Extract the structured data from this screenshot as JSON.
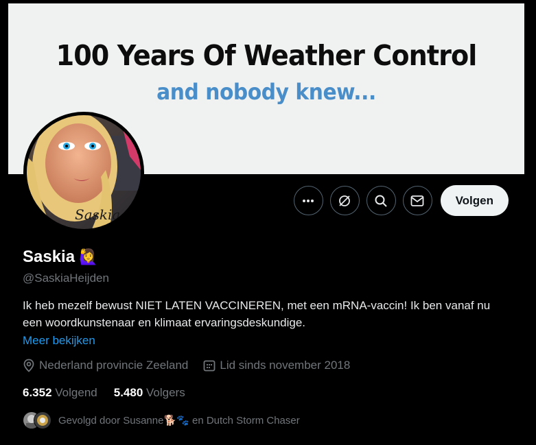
{
  "banner": {
    "line1": "100 Years Of Weather Control",
    "line2": "and nobody knew..."
  },
  "avatar": {
    "signature": "Saskia"
  },
  "actions": {
    "follow_label": "Volgen"
  },
  "profile": {
    "name": "Saskia",
    "name_emoji": "🙋‍♀️",
    "handle": "@SaskiaHeijden",
    "bio": "Ik heb mezelf bewust NIET LATEN VACCINEREN, met een mRNA-vaccin! Ik ben vanaf nu een woordkunstenaar en klimaat ervaringsdeskundige.",
    "more_link": "Meer bekijken",
    "location": "Nederland provincie Zeeland",
    "joined": "Lid sinds november 2018"
  },
  "stats": {
    "following_count": "6.352",
    "following_label": "Volgend",
    "followers_count": "5.480",
    "followers_label": "Volgers"
  },
  "followed_by": {
    "prefix": "Gevolgd door Susanne",
    "emojis": "🐕🐾",
    "suffix": " en Dutch Storm Chaser"
  },
  "colors": {
    "link": "#1d9bf0",
    "muted": "#71767b",
    "banner_blue": "#4a8ec9"
  }
}
